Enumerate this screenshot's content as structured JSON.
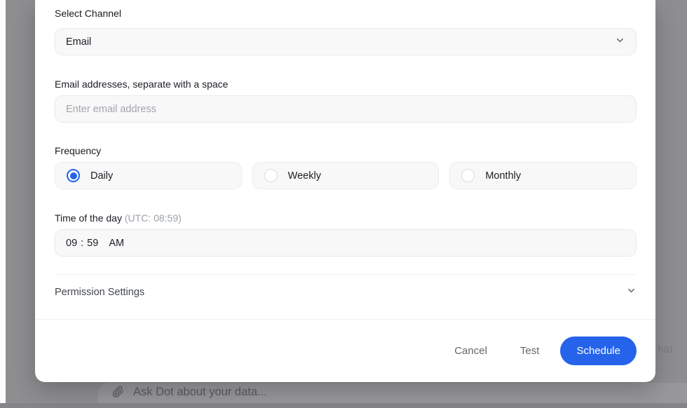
{
  "modal": {
    "channel": {
      "label": "Select Channel",
      "selected": "Email"
    },
    "email": {
      "label": "Email addresses, separate with a space",
      "placeholder": "Enter email address"
    },
    "frequency": {
      "label": "Frequency",
      "options": [
        {
          "label": "Daily",
          "selected": true
        },
        {
          "label": "Weekly",
          "selected": false
        },
        {
          "label": "Monthly",
          "selected": false
        }
      ]
    },
    "time": {
      "label": "Time of the day",
      "utc_note": "(UTC: 08:59)",
      "hour": "09",
      "separator": ":",
      "minute": "59",
      "meridiem": "AM"
    },
    "permission": {
      "label": "Permission Settings"
    },
    "footer": {
      "cancel_label": "Cancel",
      "test_label": "Test",
      "schedule_label": "Schedule"
    }
  },
  "background": {
    "chat_text_fragment": "hat",
    "chat_input_placeholder": "Ask Dot about your data..."
  },
  "colors": {
    "accent_blue": "#2563eb",
    "overlay_gray": "#8e8e91"
  }
}
